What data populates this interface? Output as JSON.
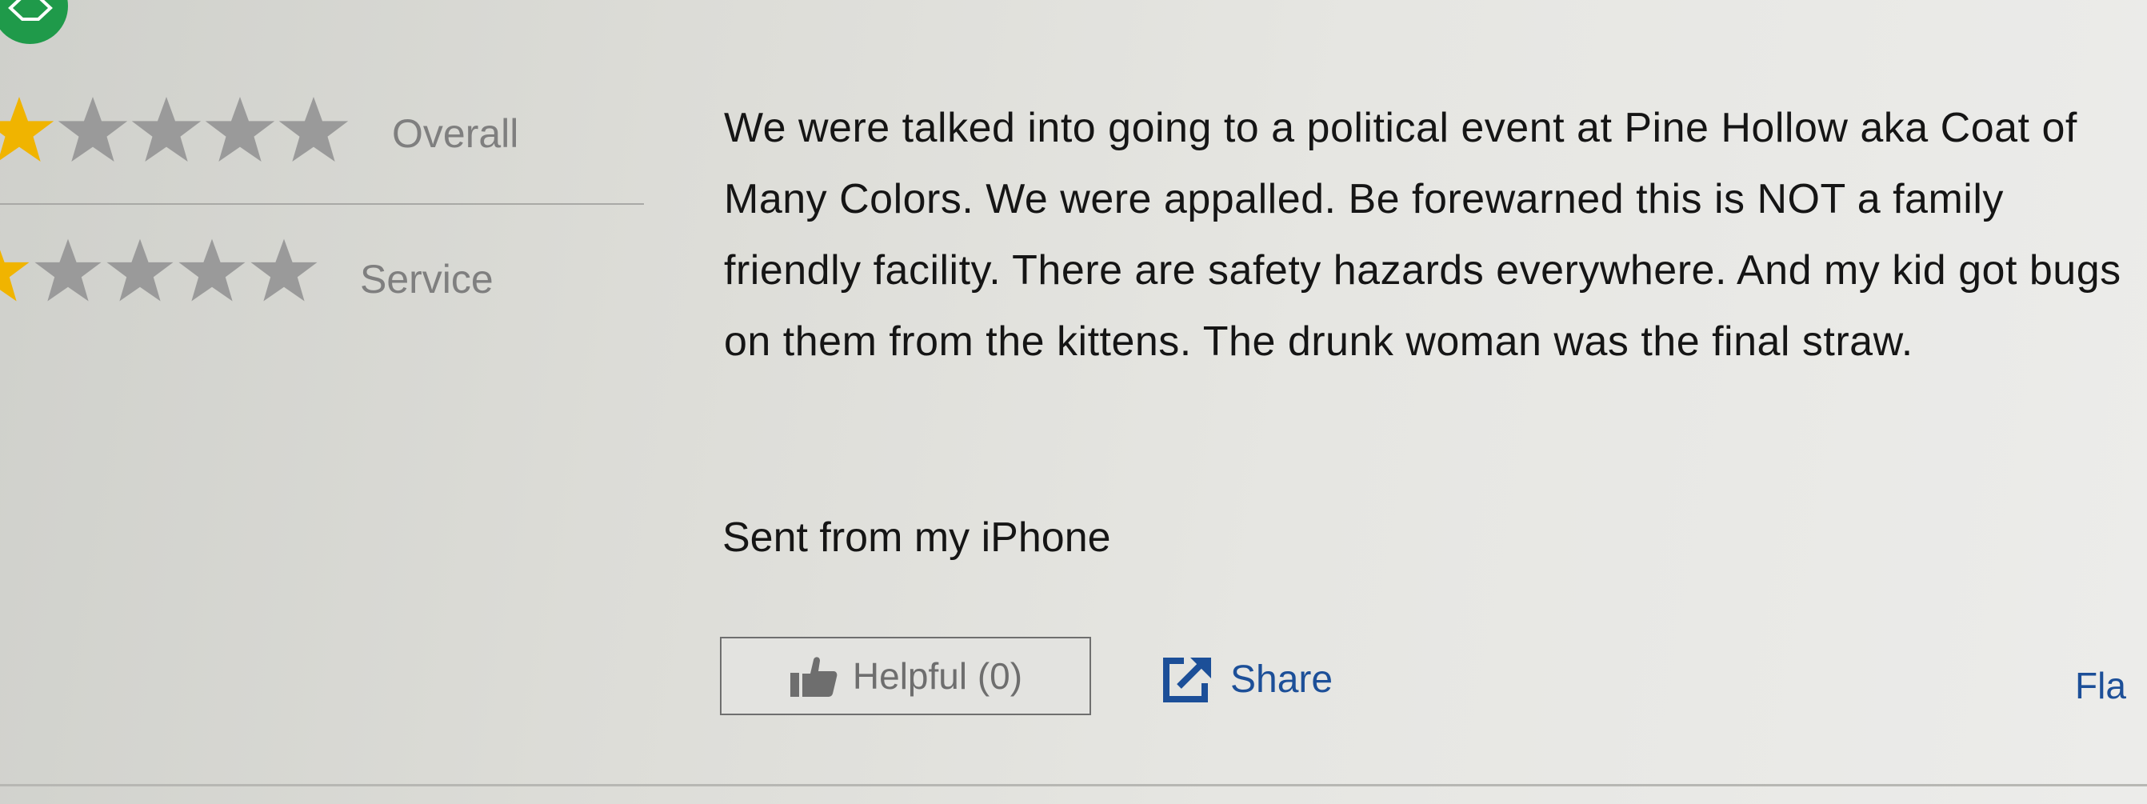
{
  "avatar": {
    "icon": "reviewer-badge-icon",
    "color": "#1f9a4a"
  },
  "ratings": [
    {
      "label": "Overall",
      "stars_filled": 0.2,
      "stars_total": 5
    },
    {
      "label": "Service",
      "stars_filled": 0.2,
      "stars_total": 5
    }
  ],
  "review": {
    "text": "We were talked into going to a political event at Pine Hollow aka Coat of Many Colors. We were appalled. Be forewarned this is NOT a family friendly facility. There are safety hazards everywhere. And my kid got bugs on them from the kittens. The drunk woman was the final straw.",
    "signature": "Sent from my iPhone"
  },
  "actions": {
    "helpful": {
      "label": "Helpful (0)",
      "icon": "thumbs-up-icon"
    },
    "share": {
      "label": "Share",
      "icon": "share-icon"
    },
    "flag": {
      "label": "Fla"
    }
  },
  "colors": {
    "star_filled": "#f0b400",
    "star_empty": "#9a9a9a",
    "link": "#1c4f98"
  }
}
